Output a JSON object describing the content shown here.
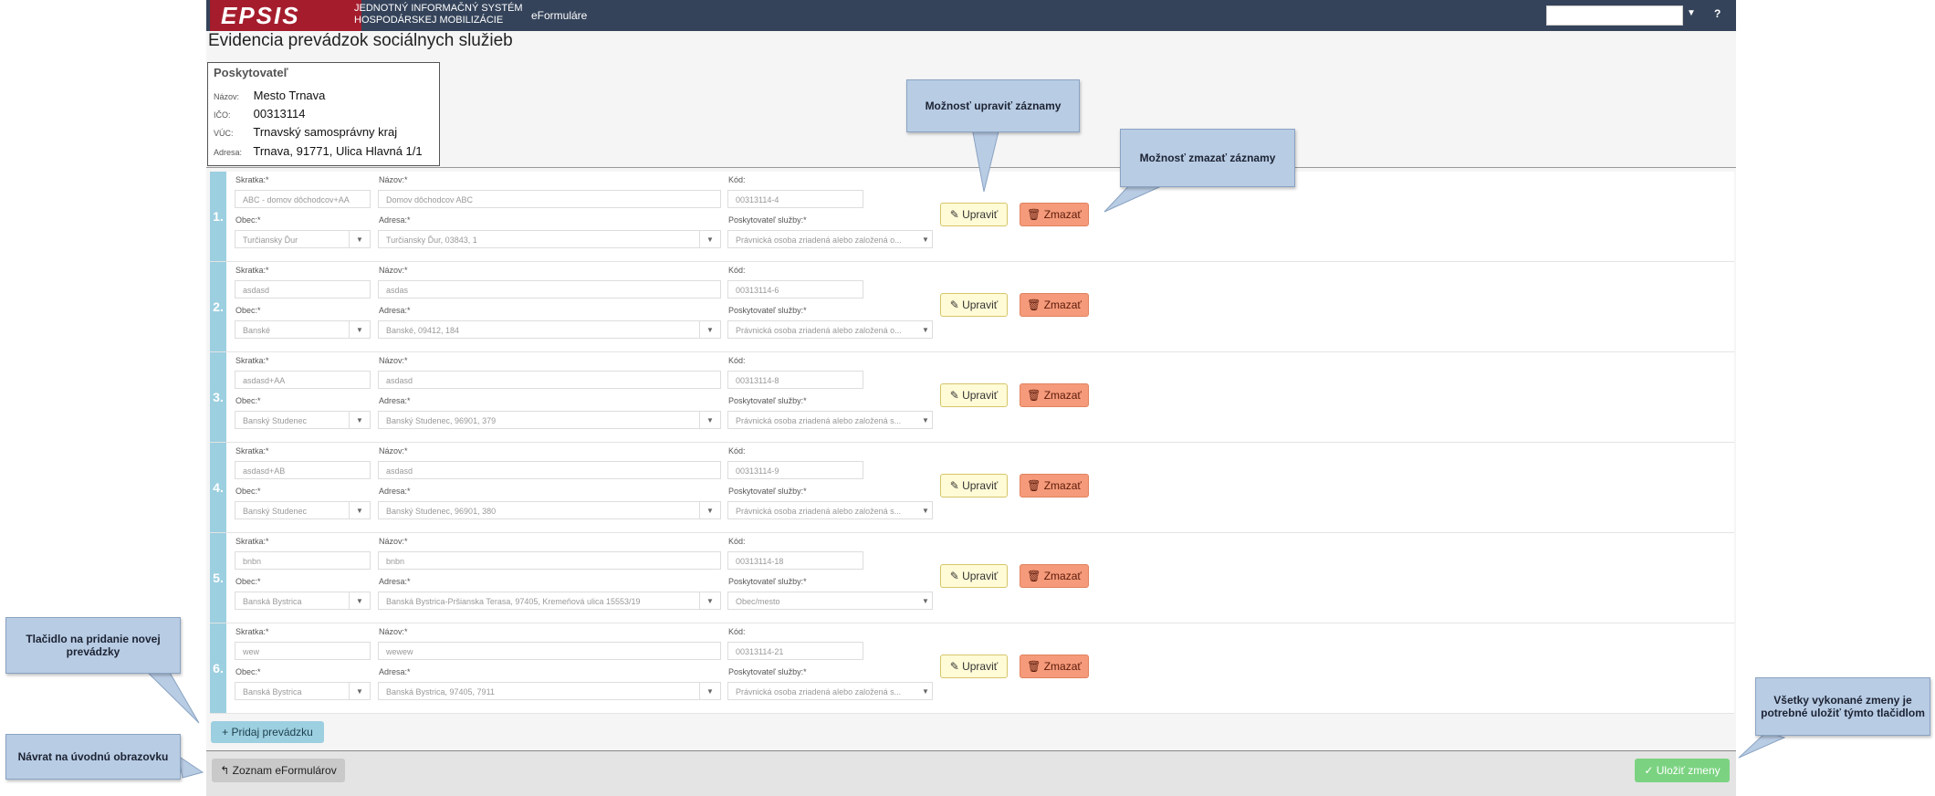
{
  "header": {
    "logo_text": "EPSIS",
    "subtitle_line1": "JEDNOTNÝ INFORMAČNÝ SYSTÉM",
    "subtitle_line2": "HOSPODÁRSKEJ MOBILIZÁCIE",
    "app_name": "eFormuláre",
    "help": "?"
  },
  "page_title": "Evidencia prevádzok sociálnych služieb",
  "provider": {
    "title": "Poskytovateľ",
    "name_label": "Názov:",
    "name": "Mesto Trnava",
    "ico_label": "IČO:",
    "ico": "00313114",
    "vuc_label": "VÚC:",
    "vuc": "Trnavský samosprávny kraj",
    "address_label": "Adresa:",
    "address": "Trnava, 91771, Ulica Hlavná 1/1"
  },
  "labels": {
    "skratka": "Skratka:*",
    "nazov": "Názov:*",
    "kod": "Kód:",
    "obec": "Obec:*",
    "adresa": "Adresa:*",
    "poskytovatel": "Poskytovateľ služby:*",
    "edit": "Upraviť",
    "delete": "Zmazať"
  },
  "rows": [
    {
      "num": "1.",
      "skratka": "ABC - domov dôchodcov+AA",
      "nazov": "Domov dôchodcov ABC",
      "kod": "00313114-4",
      "obec": "Turčiansky Ďur",
      "adresa": "Turčiansky Ďur, 03843, 1",
      "poskytovatel": "Právnická osoba zriadená alebo založená o..."
    },
    {
      "num": "2.",
      "skratka": "asdasd",
      "nazov": "asdas",
      "kod": "00313114-6",
      "obec": "Banské",
      "adresa": "Banské, 09412, 184",
      "poskytovatel": "Právnická osoba zriadená alebo založená o..."
    },
    {
      "num": "3.",
      "skratka": "asdasd+AA",
      "nazov": "asdasd",
      "kod": "00313114-8",
      "obec": "Banský Studenec",
      "adresa": "Banský Studenec, 96901, 379",
      "poskytovatel": "Právnická osoba zriadená alebo založená s..."
    },
    {
      "num": "4.",
      "skratka": "asdasd+AB",
      "nazov": "asdasd",
      "kod": "00313114-9",
      "obec": "Banský Studenec",
      "adresa": "Banský Studenec, 96901, 380",
      "poskytovatel": "Právnická osoba zriadená alebo založená s..."
    },
    {
      "num": "5.",
      "skratka": "bnbn",
      "nazov": "bnbn",
      "kod": "00313114-18",
      "obec": "Banská Bystrica",
      "adresa": "Banská Bystrica-Pršianska Terasa, 97405, Kremeňová ulica 15553/19",
      "poskytovatel": "Obec/mesto"
    },
    {
      "num": "6.",
      "skratka": "wew",
      "nazov": "wewew",
      "kod": "00313114-21",
      "obec": "Banská Bystrica",
      "adresa": "Banská Bystrica, 97405, 7911",
      "poskytovatel": "Právnická osoba zriadená alebo založená s..."
    }
  ],
  "buttons": {
    "add": "+ Pridaj prevádzku",
    "back": "Zoznam eFormulárov",
    "save": "Uložiť zmeny"
  },
  "callouts": {
    "edit": "Možnosť upraviť záznamy",
    "delete": "Možnosť zmazať záznamy",
    "add": "Tlačidlo na pridanie novej prevádzky",
    "back": "Návrat na úvodnú obrazovku",
    "save": "Všetky vykonané zmeny je potrebné uložiť týmto tlačidlom"
  }
}
